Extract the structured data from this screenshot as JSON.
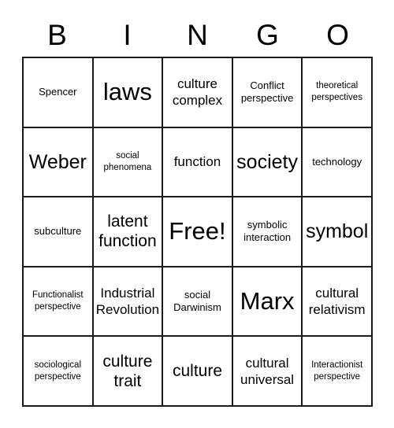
{
  "header": {
    "letters": [
      "B",
      "I",
      "N",
      "G",
      "O"
    ]
  },
  "grid": {
    "rows": [
      [
        {
          "text": "Spencer",
          "size": "sm"
        },
        {
          "text": "laws",
          "size": "xxl"
        },
        {
          "text": "culture complex",
          "size": "md"
        },
        {
          "text": "Conflict perspective",
          "size": "sm"
        },
        {
          "text": "theoretical perspectives",
          "size": "xs"
        }
      ],
      [
        {
          "text": "Weber",
          "size": "xl"
        },
        {
          "text": "social phenomena",
          "size": "xs"
        },
        {
          "text": "function",
          "size": "md"
        },
        {
          "text": "society",
          "size": "xl"
        },
        {
          "text": "technology",
          "size": "sm"
        }
      ],
      [
        {
          "text": "subculture",
          "size": "sm"
        },
        {
          "text": "latent function",
          "size": "lg"
        },
        {
          "text": "Free!",
          "size": "xxl"
        },
        {
          "text": "symbolic interaction",
          "size": "sm"
        },
        {
          "text": "symbol",
          "size": "xl"
        }
      ],
      [
        {
          "text": "Functionalist perspective",
          "size": "xs"
        },
        {
          "text": "Industrial Revolution",
          "size": "md"
        },
        {
          "text": "social Darwinism",
          "size": "sm"
        },
        {
          "text": "Marx",
          "size": "xxl"
        },
        {
          "text": "cultural relativism",
          "size": "md"
        }
      ],
      [
        {
          "text": "sociological perspective",
          "size": "xs"
        },
        {
          "text": "culture trait",
          "size": "lg"
        },
        {
          "text": "culture",
          "size": "lg"
        },
        {
          "text": "cultural universal",
          "size": "md"
        },
        {
          "text": "Interactionist perspective",
          "size": "xs"
        }
      ]
    ]
  }
}
